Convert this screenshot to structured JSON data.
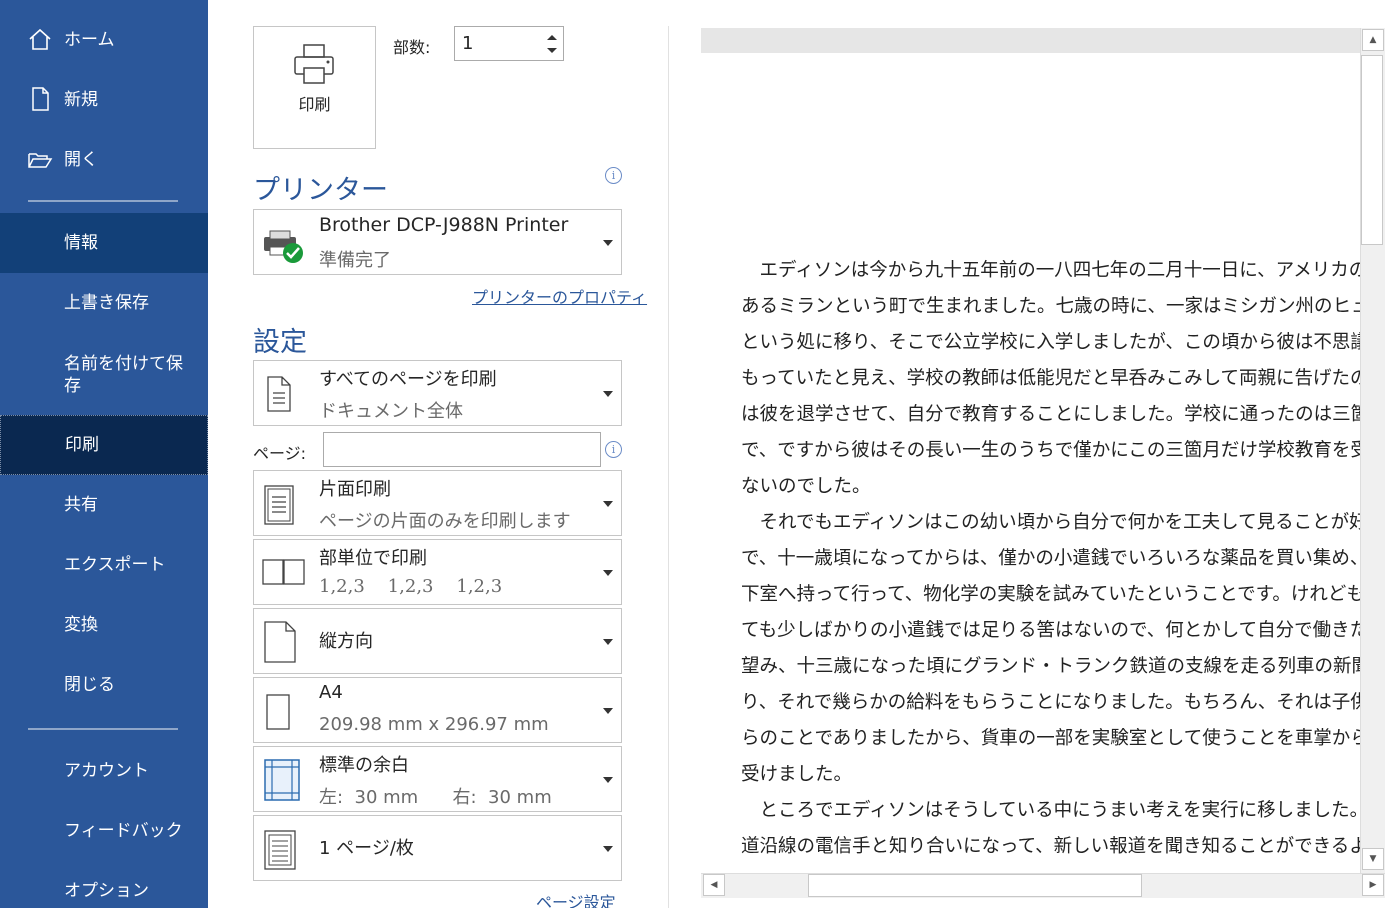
{
  "sidebar": {
    "home": "ホーム",
    "new": "新規",
    "open": "開く",
    "info": "情報",
    "save": "上書き保存",
    "save_as": "名前を付けて保存",
    "print": "印刷",
    "share": "共有",
    "export": "エクスポート",
    "transform": "変換",
    "close": "閉じる",
    "account": "アカウント",
    "feedback": "フィードバック",
    "options": "オプション"
  },
  "print": {
    "button_label": "印刷",
    "copies_label": "部数:",
    "copies_value": "1"
  },
  "printer": {
    "section_title": "プリンター",
    "name": "Brother DCP-J988N Printer",
    "status": "準備完了",
    "properties_link": "プリンターのプロパティ"
  },
  "settings": {
    "section_title": "設定",
    "range_title": "すべてのページを印刷",
    "range_sub": "ドキュメント全体",
    "pages_label": "ページ:",
    "pages_value": "",
    "sides_title": "片面印刷",
    "sides_sub": "ページの片面のみを印刷します",
    "collate_title": "部単位で印刷",
    "collate_sub": "1,2,3    1,2,3    1,2,3",
    "orientation": "縦方向",
    "paper_title": "A4",
    "paper_sub": "209.98 mm x 296.97 mm",
    "margin_title": "標準の余白",
    "margin_sub": "左:  30 mm      右:  30 mm",
    "pps": "1 ページ/枚",
    "page_setup_link": "ページ設定"
  },
  "preview": {
    "text": "　エディソンは今から九十五年前の一八四七年の二月十一日に、アメリカの\nあるミランという町で生まれました。七歳の時に、一家はミシガン州のヒューロン\nという処に移り、そこで公立学校に入学しましたが、この頃から彼は不思議な\nもっていたと見え、学校の教師は低能児だと早呑みこみして両親に告げたので、\nは彼を退学させて、自分で教育することにしました。学校に通ったのは三箇月\nで、ですから彼はその長い一生のうちで僅かにこの三箇月だけ学校教育を受け\nないのでした。\n　それでもエディソンはこの幼い頃から自分で何かを工夫して見ることが好き\nで、十一歳頃になってからは、僅かの小遣銭でいろいろな薬品を買い集め、地\n下室へ持って行って、物化学の実験を試みていたということです。けれどもどう\nても少しばかりの小遣銭では足りる筈はないので、何とかして自分で働きたいと\n望み、十三歳になった頃にグランド・トランク鉄道の支線を走る列車の新聞売\nり、それで幾らかの給料をもらうことになりました。もちろん、それは子供なが\nらのことでありましたから、貨車の一部を実験室として使うことを車掌から許\n受けました。\n　ところでエディソンはそうしている中にうまい考えを実行に移しました。それは\n道沿線の電信手と知り合いになって、新しい報道を聞き知ることができるよう"
  },
  "colors": {
    "sidebar_bg": "#2b579a",
    "sidebar_active": "#0a2850",
    "accent": "#2b579a"
  }
}
